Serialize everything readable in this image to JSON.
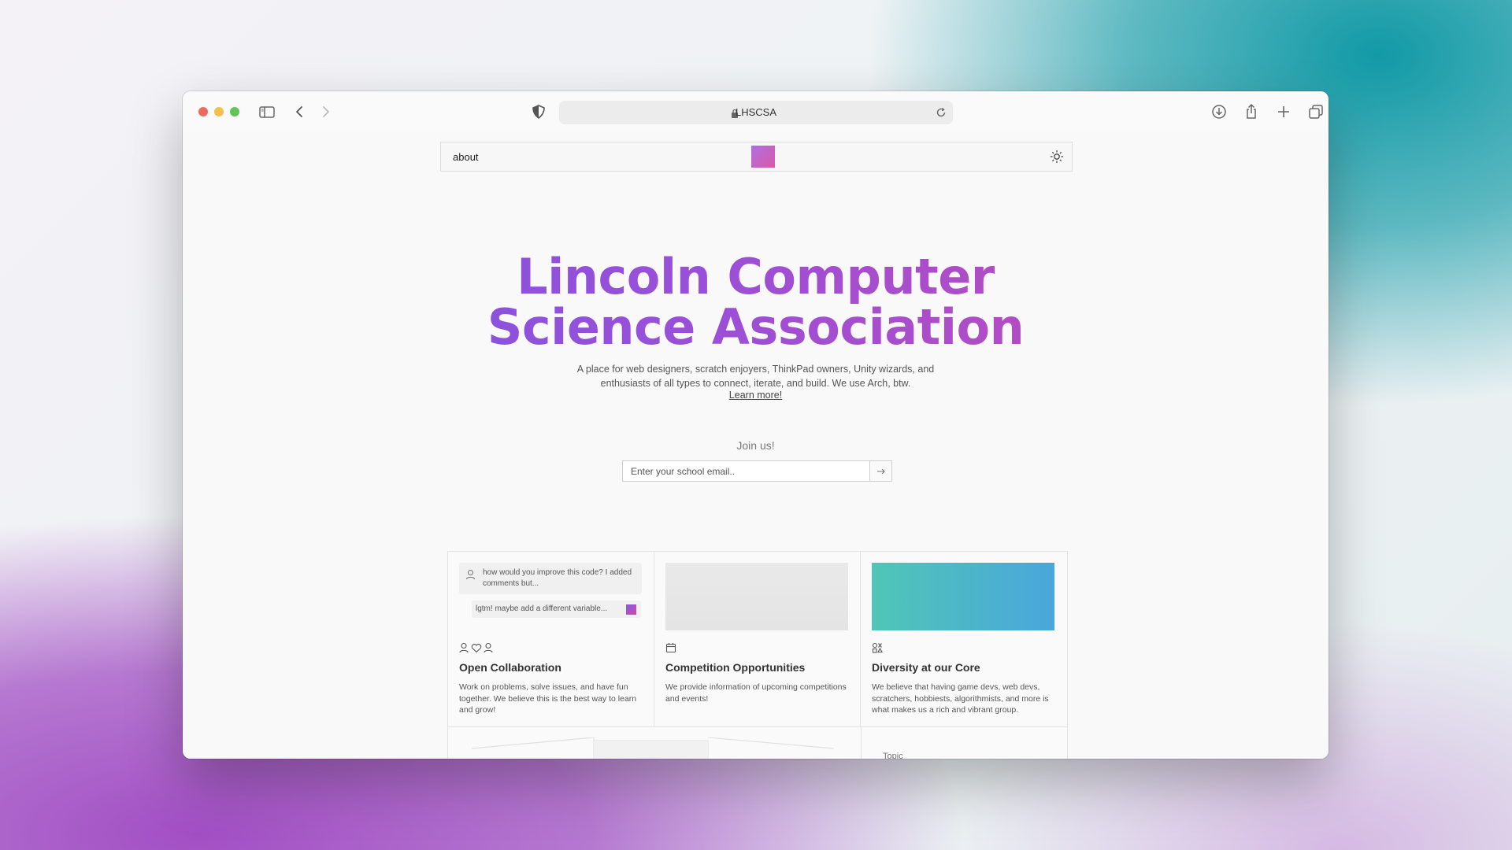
{
  "browser": {
    "url_label": "LHSCSA"
  },
  "site": {
    "nav": {
      "about_label": "about"
    },
    "hero": {
      "title_line1": "Lincoln Computer",
      "title_line2": "Science Association",
      "description": "A place for web designers, scratch enjoyers, ThinkPad owners, Unity wizards, and enthusiasts of all types to connect, iterate, and build. We use Arch, btw.",
      "learn_more": "Learn more!"
    },
    "join": {
      "label": "Join us!",
      "email_placeholder": "Enter your school email.."
    },
    "cards": [
      {
        "title": "Open Collaboration",
        "description": "Work on problems, solve issues, and have fun together. We believe this is the best way to learn and grow!",
        "chat_message": "how would you improve this code? I added comments but...",
        "chat_reply": "lgtm! maybe add a different variable..."
      },
      {
        "title": "Competition Opportunities",
        "description": "We provide information of upcoming competitions and events!"
      },
      {
        "title": "Diversity at our Core",
        "description": "We believe that having game devs, web devs, scratchers, hobbiests, algorithmists, and more is what makes us a rich and vibrant group."
      }
    ],
    "second_row": {
      "topic_label": "Topic"
    }
  },
  "icons": {
    "sidebar": "sidebar-icon",
    "back": "chevron-left-icon",
    "forward": "chevron-right-icon",
    "privacy": "shield-icon",
    "lock": "lock-icon",
    "reload": "reload-icon",
    "download": "download-icon",
    "share": "share-icon",
    "new_tab": "plus-icon",
    "tabs": "tabs-overview-icon",
    "theme": "sun-icon",
    "submit": "arrow-right-icon"
  },
  "colors": {
    "title_gradient_start": "#7a55e6",
    "title_gradient_end": "#c94ab2",
    "card3_gradient_start": "#4fc6b6",
    "card3_gradient_end": "#4aa6db"
  }
}
